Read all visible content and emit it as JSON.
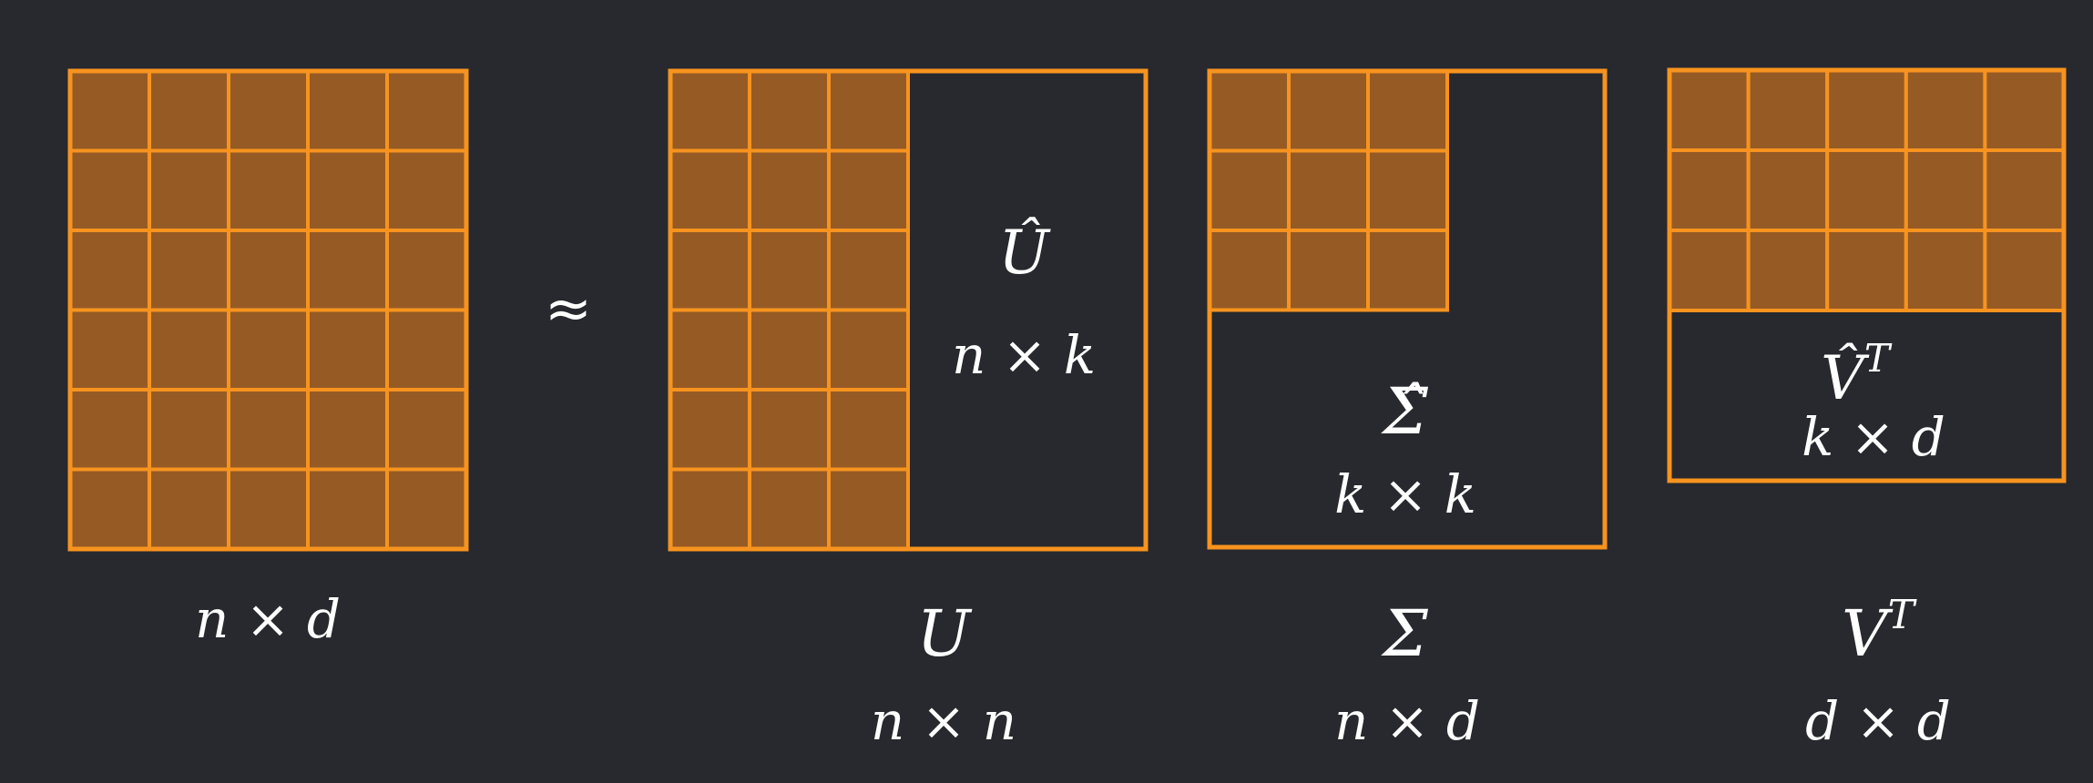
{
  "approx_symbol": "≈",
  "colors": {
    "background": "#27292e",
    "cell_fill": "#965b25",
    "cell_stroke": "#f7931e",
    "text": "#ffffff"
  },
  "matrices": {
    "A": {
      "dim_label": "n × d",
      "rows": 6,
      "cols": 5
    },
    "U": {
      "name": "U",
      "dim_label": "n × n",
      "inner_name": "Û",
      "inner_dim": "n × k",
      "rows": 6,
      "filled_cols": 3
    },
    "Sigma": {
      "name": "Σ",
      "dim_label": "n × d",
      "inner_name": "Σ̂",
      "inner_dim": "k × k",
      "filled_rows": 3,
      "filled_cols": 3
    },
    "VT": {
      "name": "V",
      "name_sup": "T",
      "dim_label": "d × d",
      "inner_name": "V̂",
      "inner_sup": "T",
      "inner_dim": "k × d",
      "filled_rows": 3,
      "cols": 5
    }
  }
}
